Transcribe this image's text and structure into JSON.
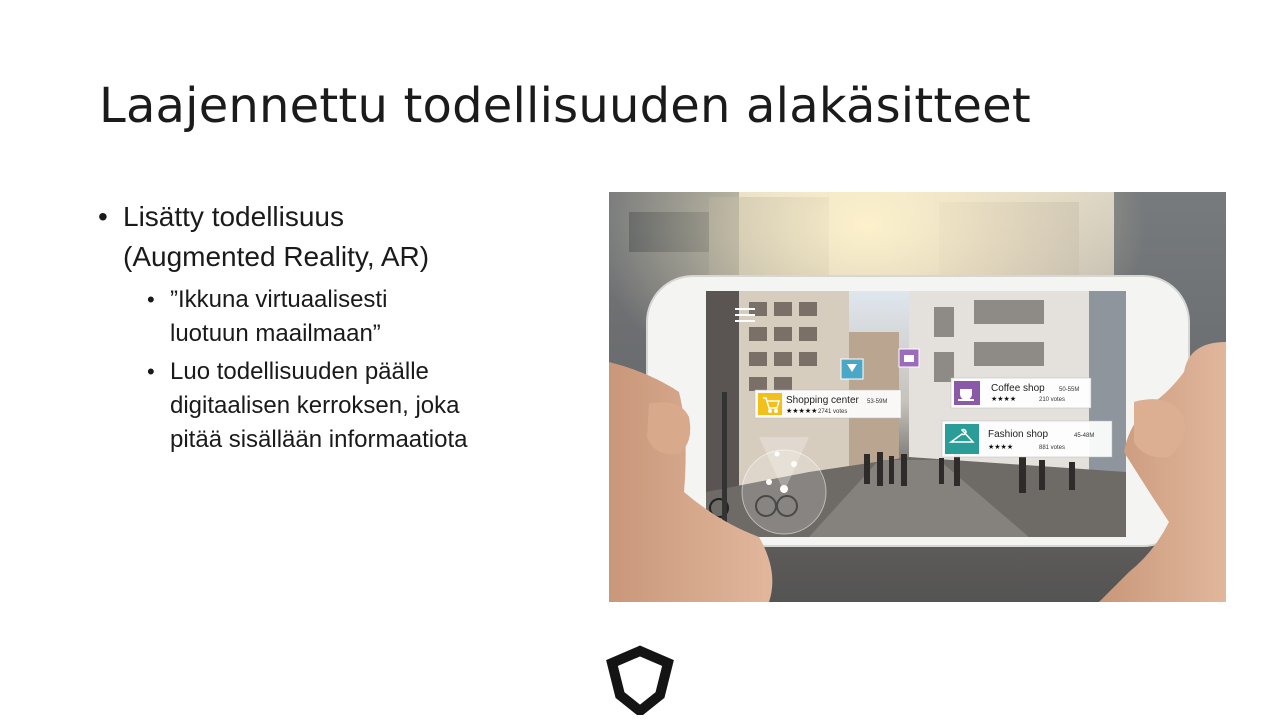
{
  "slide": {
    "title": "Laajennettu todellisuuden alakäsitteet",
    "bullet": {
      "line1": "Lisätty todellisuus",
      "line2": "(Augmented Reality, AR)",
      "subbullets": [
        {
          "line1": "”Ikkuna virtuaalisesti",
          "line2": "luotuun maailmaan”"
        },
        {
          "line1": "Luo todellisuuden päälle",
          "line2": "digitaalisen kerroksen, joka",
          "line3": "pitää sisällään informaatiota"
        }
      ]
    }
  },
  "photo": {
    "pois": [
      {
        "name": "Shopping center",
        "distance": "53-59M",
        "stars": "★★★★★",
        "votes": "2741 votes",
        "color": "#f2c018"
      },
      {
        "name": "Coffee shop",
        "distance": "50-55M",
        "stars": "★★★★",
        "votes": "210 votes",
        "color": "#8a5aa8"
      },
      {
        "name": "Fashion shop",
        "distance": "45-48M",
        "stars": "★★★★",
        "votes": "881 votes",
        "color": "#2a9d99"
      }
    ]
  },
  "logo": {
    "icon": "shield-icon"
  }
}
